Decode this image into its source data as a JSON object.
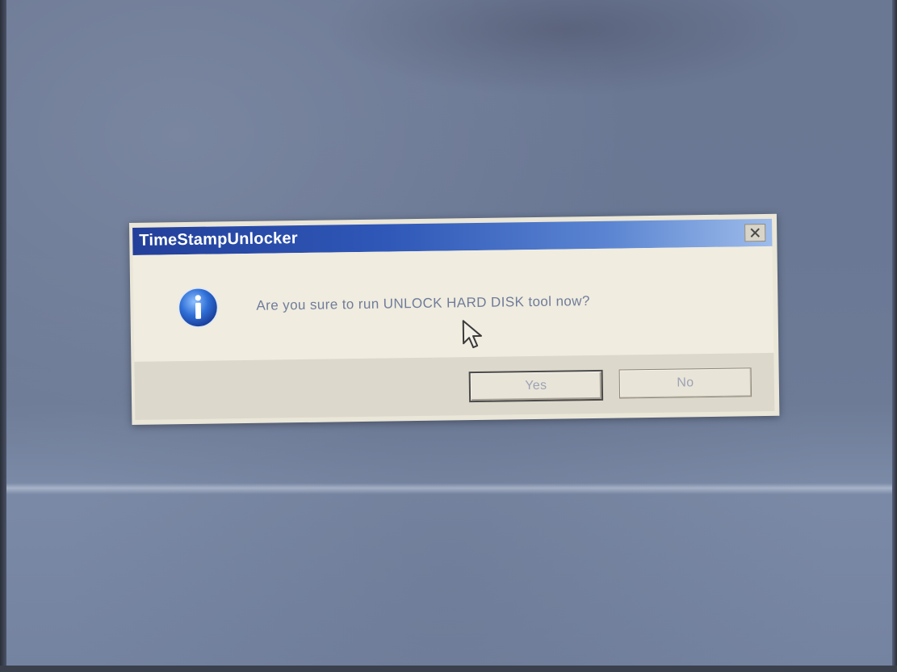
{
  "dialog": {
    "title": "TimeStampUnlocker",
    "message": "Are you sure to run UNLOCK HARD DISK tool now?",
    "icon": "info-icon",
    "buttons": {
      "yes_label": "Yes",
      "no_label": "No"
    }
  },
  "colors": {
    "titlebar_start": "#233f9a",
    "titlebar_end": "#9ebcea",
    "dialog_bg": "#eae6d8",
    "message_text": "#6f7c9a"
  }
}
